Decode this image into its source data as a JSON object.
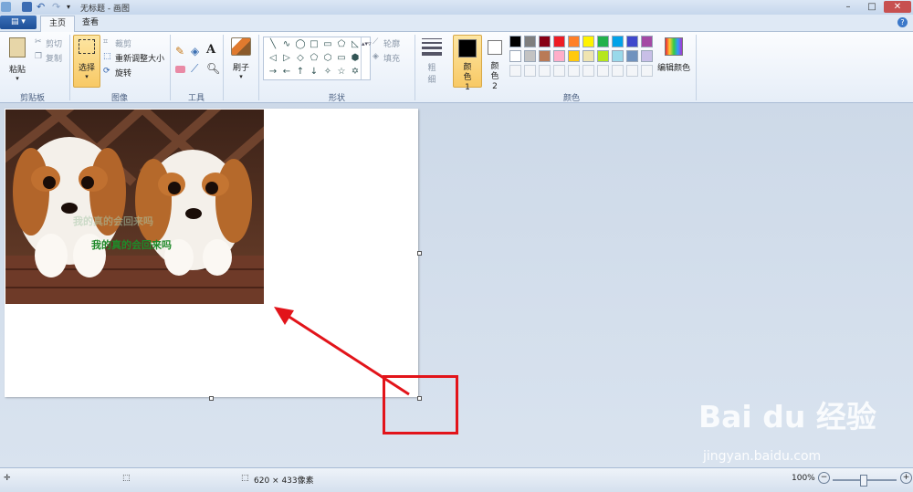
{
  "title_bar": {
    "title": "无标题 - 画图",
    "minimize": "–",
    "maximize": "□",
    "close": "✕"
  },
  "tabs": [
    {
      "label": "主页"
    },
    {
      "label": "查看"
    }
  ],
  "file_menu": {
    "label": "▤ ▾"
  },
  "help": {
    "label": "?"
  },
  "clipboard": {
    "paste_label": "粘贴",
    "cut_label": "剪切",
    "copy_label": "复制",
    "group_label": "剪贴板"
  },
  "image": {
    "select_label": "选择",
    "crop_label": "裁剪",
    "resize_label": "重新调整大小",
    "rotate_label": "旋转",
    "group_label": "图像"
  },
  "tools": {
    "group_label": "工具"
  },
  "brushes": {
    "label": "刷子"
  },
  "shapes": {
    "outline_label": "轮廓",
    "fill_label": "填充",
    "group_label": "形状",
    "glyphs": [
      "╲",
      "∿",
      "◯",
      "□",
      "▭",
      "⬠",
      "◺",
      "◁",
      "▷",
      "◇",
      "⬠",
      "⬡",
      "▭",
      "⬢",
      "→",
      "←",
      "↑",
      "↓",
      "✧",
      "☆",
      "✡",
      "✶",
      "▭",
      "◯",
      "☁"
    ]
  },
  "size": {
    "label_1": "粗",
    "label_2": "细"
  },
  "colors": {
    "color1_label": "颜色 1",
    "color2_label": "颜色 2",
    "edit_colors_label": "编辑颜色",
    "group_label": "颜色",
    "color1": "#000000",
    "color2": "#ffffff",
    "palette_row1": [
      "#000000",
      "#7f7f7f",
      "#880015",
      "#ed1c24",
      "#ff7f27",
      "#fff200",
      "#22b14c",
      "#00a2e8",
      "#3f48cc",
      "#a349a4"
    ],
    "palette_row2": [
      "#ffffff",
      "#c3c3c3",
      "#b97a57",
      "#ffaec9",
      "#ffc90e",
      "#efe4b0",
      "#b5e61d",
      "#99d9ea",
      "#7092be",
      "#c8bfe7"
    ]
  },
  "canvas": {
    "watermark_faint": "我的真的会回来吗",
    "watermark_text": "我的真的会回来吗"
  },
  "watermark": {
    "logo": "Bai du 经验",
    "url": "jingyan.baidu.com"
  },
  "status": {
    "dimensions": "620 × 433像素",
    "zoom": "100%",
    "zoom_out": "−",
    "zoom_in": "+"
  }
}
